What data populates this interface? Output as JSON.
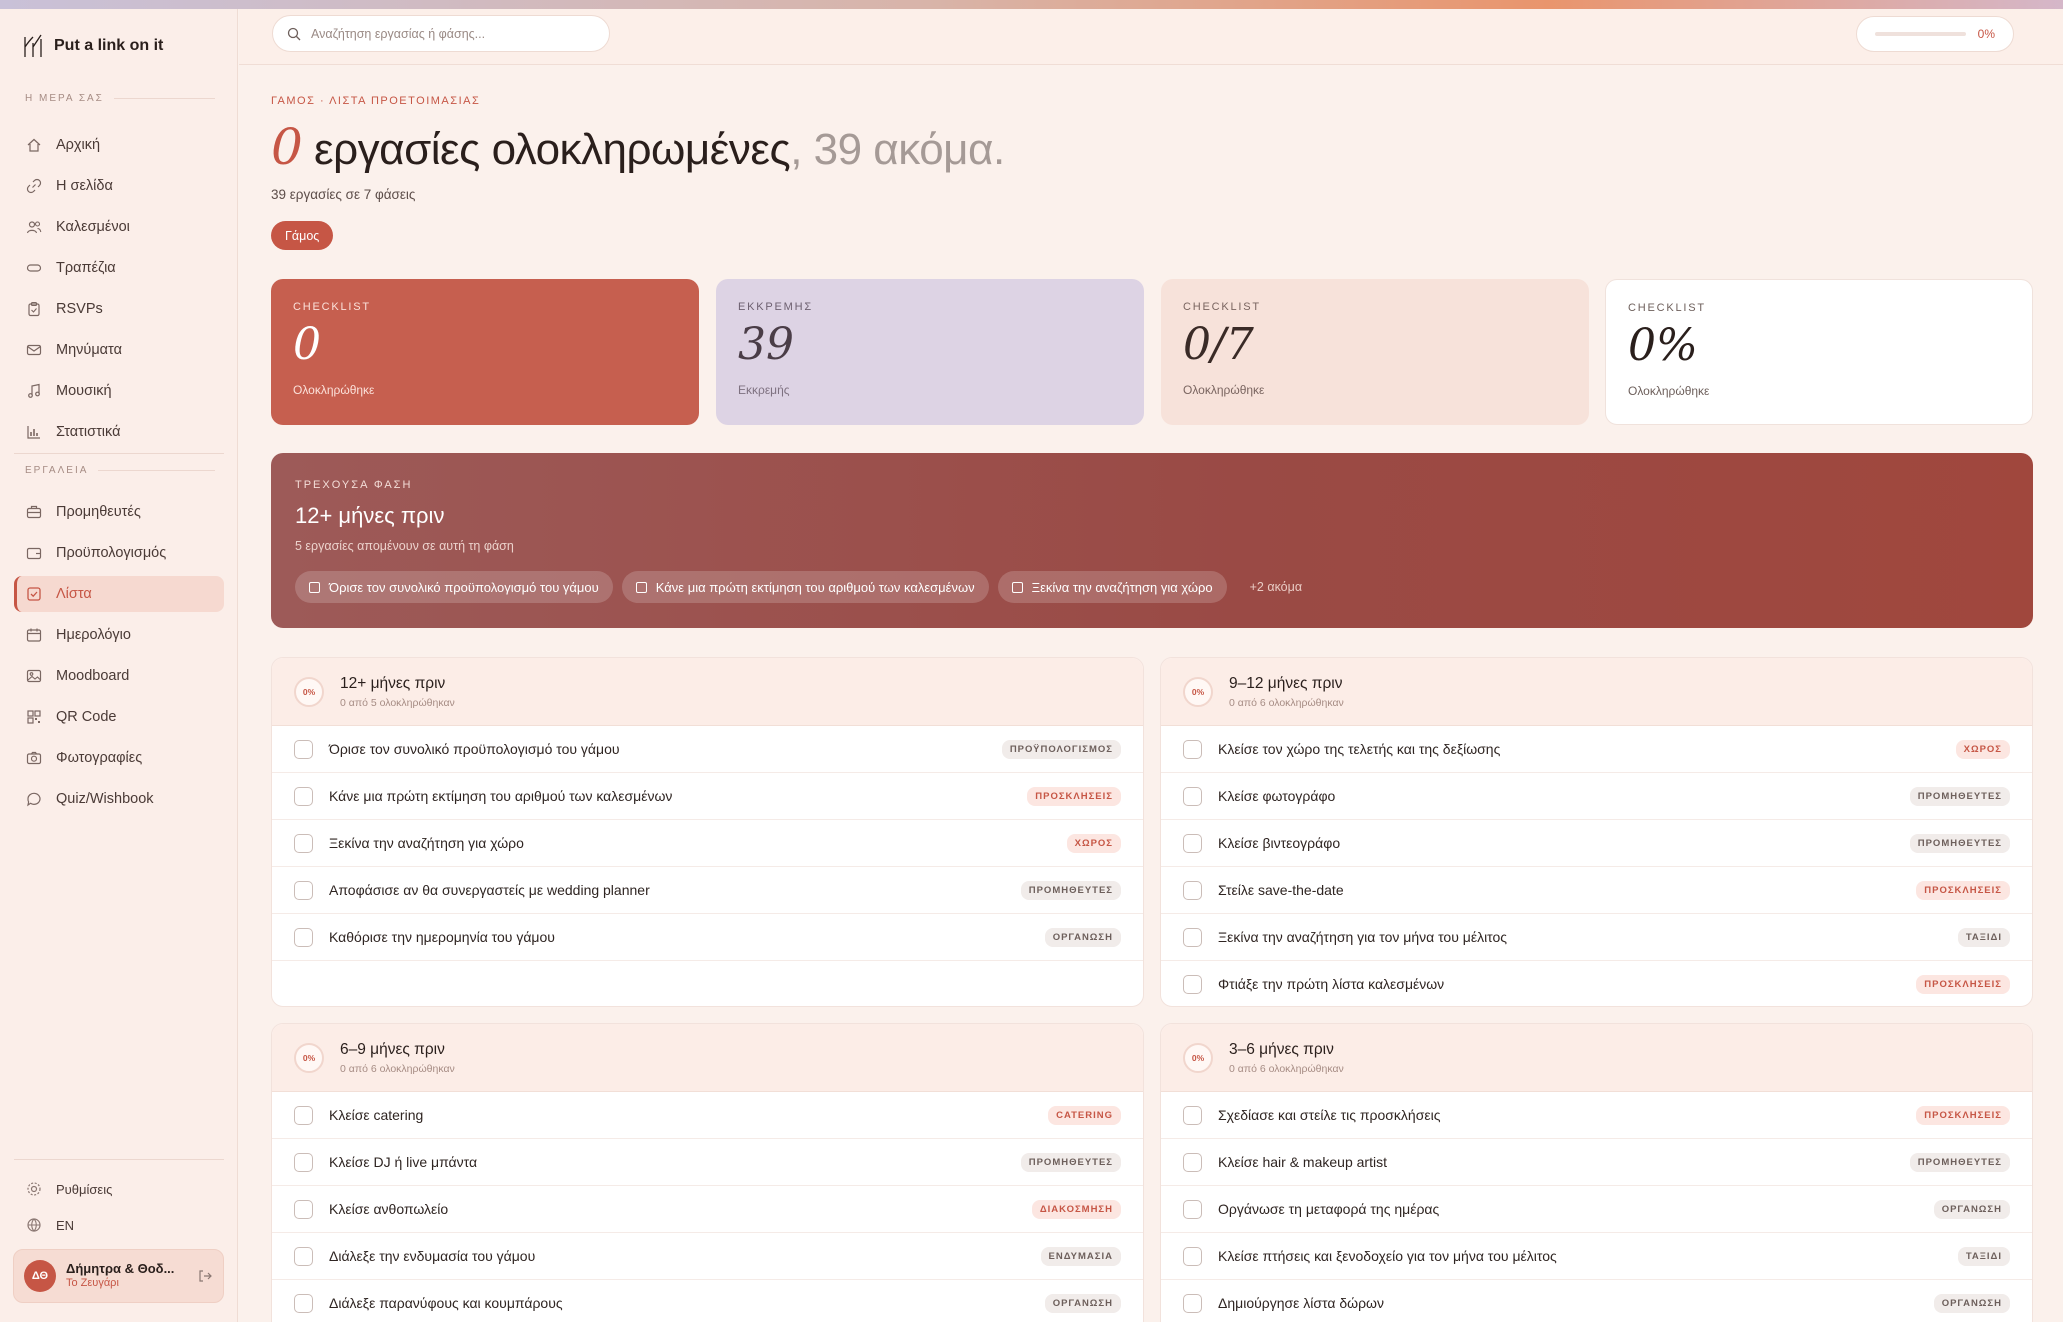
{
  "app": {
    "name": "Put a link on it"
  },
  "sidebar": {
    "section_day": "Η ΜΕΡΑ ΣΑΣ",
    "section_tools": "ΕΡΓΑΛΕΙΑ",
    "items_day": [
      {
        "label": "Αρχική",
        "icon": "home-icon"
      },
      {
        "label": "Η σελίδα",
        "icon": "link-icon"
      },
      {
        "label": "Καλεσμένοι",
        "icon": "users-icon"
      },
      {
        "label": "Τραπέζια",
        "icon": "table-icon"
      },
      {
        "label": "RSVPs",
        "icon": "clipboard-icon"
      },
      {
        "label": "Μηνύματα",
        "icon": "mail-icon"
      },
      {
        "label": "Μουσική",
        "icon": "music-icon"
      },
      {
        "label": "Στατιστικά",
        "icon": "chart-icon"
      }
    ],
    "items_tools": [
      {
        "label": "Προμηθευτές",
        "icon": "briefcase-icon"
      },
      {
        "label": "Προϋπολογισμός",
        "icon": "wallet-icon"
      },
      {
        "label": "Λίστα",
        "icon": "checklist-icon",
        "active": true
      },
      {
        "label": "Ημερολόγιο",
        "icon": "calendar-icon"
      },
      {
        "label": "Moodboard",
        "icon": "image-icon"
      },
      {
        "label": "QR Code",
        "icon": "qr-icon"
      },
      {
        "label": "Φωτογραφίες",
        "icon": "camera-icon"
      },
      {
        "label": "Quiz/Wishbook",
        "icon": "chat-icon"
      }
    ],
    "settings_label": "Ρυθμίσεις",
    "language_label": "EN",
    "user": {
      "initials": "ΔΘ",
      "name": "Δήμητρα & Θοδ...",
      "role": "Το Ζευγάρι"
    }
  },
  "header": {
    "search_placeholder": "Αναζήτηση εργασίας ή φάσης...",
    "progress_label": "0%",
    "progress_value": 0
  },
  "main": {
    "breadcrumb": "ΓΑΜΟΣ · ΛΙΣΤΑ ΠΡΟΕΤΟΙΜΑΣΙΑΣ",
    "headline_number": "0",
    "headline_text": " εργασίες ολοκληρωμένες",
    "headline_rest": ", 39 ακόμα.",
    "subline": "39 εργασίες σε 7 φάσεις",
    "filter_chip": "Γάμος"
  },
  "stats": [
    {
      "label": "CHECKLIST",
      "value": "0",
      "caption": "Ολοκληρώθηκε"
    },
    {
      "label": "ΕΚΚΡΕΜΗΣ",
      "value": "39",
      "caption": "Εκκρεμής"
    },
    {
      "label": "CHECKLIST",
      "value": "0/7",
      "caption": "Ολοκληρώθηκε"
    },
    {
      "label": "CHECKLIST",
      "value": "0%",
      "caption": "Ολοκληρώθηκε"
    }
  ],
  "current_phase": {
    "label": "ΤΡΕΧΟΥΣΑ ΦΑΣΗ",
    "title": "12+ μήνες πριν",
    "subtitle": "5 εργασίες απομένουν σε αυτή τη φάση",
    "chips": [
      "Όρισε τον συνολικό προϋπολογισμό του γάμου",
      "Κάνε μια πρώτη εκτίμηση του αριθμού των καλεσμένων",
      "Ξεκίνα την αναζήτηση για χώρο"
    ],
    "more": "+2 ακόμα"
  },
  "phases": [
    {
      "pct": "0%",
      "title": "12+ μήνες πριν",
      "count": "0 από 5 ολοκληρώθηκαν",
      "tasks": [
        {
          "text": "Όρισε τον συνολικό προϋπολογισμό του γάμου",
          "tag": "ΠΡΟΫΠΟΛΟΓΙΣΜΟΣ",
          "tone": "gray"
        },
        {
          "text": "Κάνε μια πρώτη εκτίμηση του αριθμού των καλεσμένων",
          "tag": "ΠΡΟΣΚΛΗΣΕΙΣ",
          "tone": "red"
        },
        {
          "text": "Ξεκίνα την αναζήτηση για χώρο",
          "tag": "ΧΩΡΟΣ",
          "tone": "red"
        },
        {
          "text": "Αποφάσισε αν θα συνεργαστείς με wedding planner",
          "tag": "ΠΡΟΜΗΘΕΥΤΕΣ",
          "tone": "gray"
        },
        {
          "text": "Καθόρισε την ημερομηνία του γάμου",
          "tag": "ΟΡΓΑΝΩΣΗ",
          "tone": "gray"
        }
      ]
    },
    {
      "pct": "0%",
      "title": "9–12 μήνες πριν",
      "count": "0 από 6 ολοκληρώθηκαν",
      "tasks": [
        {
          "text": "Κλείσε τον χώρο της τελετής και της δεξίωσης",
          "tag": "ΧΩΡΟΣ",
          "tone": "red"
        },
        {
          "text": "Κλείσε φωτογράφο",
          "tag": "ΠΡΟΜΗΘΕΥΤΕΣ",
          "tone": "gray"
        },
        {
          "text": "Κλείσε βιντεογράφο",
          "tag": "ΠΡΟΜΗΘΕΥΤΕΣ",
          "tone": "gray"
        },
        {
          "text": "Στείλε save-the-date",
          "tag": "ΠΡΟΣΚΛΗΣΕΙΣ",
          "tone": "red"
        },
        {
          "text": "Ξεκίνα την αναζήτηση για τον μήνα του μέλιτος",
          "tag": "ΤΑΞΙΔΙ",
          "tone": "gray"
        },
        {
          "text": "Φτιάξε την πρώτη λίστα καλεσμένων",
          "tag": "ΠΡΟΣΚΛΗΣΕΙΣ",
          "tone": "red"
        }
      ]
    },
    {
      "pct": "0%",
      "title": "6–9 μήνες πριν",
      "count": "0 από 6 ολοκληρώθηκαν",
      "tasks": [
        {
          "text": "Κλείσε catering",
          "tag": "CATERING",
          "tone": "red"
        },
        {
          "text": "Κλείσε DJ ή live μπάντα",
          "tag": "ΠΡΟΜΗΘΕΥΤΕΣ",
          "tone": "gray"
        },
        {
          "text": "Κλείσε ανθοπωλείο",
          "tag": "ΔΙΑΚΟΣΜΗΣΗ",
          "tone": "red"
        },
        {
          "text": "Διάλεξε την ενδυμασία του γάμου",
          "tag": "ΕΝΔΥΜΑΣΙΑ",
          "tone": "gray"
        },
        {
          "text": "Διάλεξε παρανύφους και κουμπάρους",
          "tag": "ΟΡΓΑΝΩΣΗ",
          "tone": "gray"
        }
      ]
    },
    {
      "pct": "0%",
      "title": "3–6 μήνες πριν",
      "count": "0 από 6 ολοκληρώθηκαν",
      "tasks": [
        {
          "text": "Σχεδίασε και στείλε τις προσκλήσεις",
          "tag": "ΠΡΟΣΚΛΗΣΕΙΣ",
          "tone": "red"
        },
        {
          "text": "Κλείσε hair & makeup artist",
          "tag": "ΠΡΟΜΗΘΕΥΤΕΣ",
          "tone": "gray"
        },
        {
          "text": "Οργάνωσε τη μεταφορά της ημέρας",
          "tag": "ΟΡΓΑΝΩΣΗ",
          "tone": "gray"
        },
        {
          "text": "Κλείσε πτήσεις και ξενοδοχείο για τον μήνα του μέλιτος",
          "tag": "ΤΑΞΙΔΙ",
          "tone": "gray"
        },
        {
          "text": "Δημιούργησε λίστα δώρων",
          "tag": "ΟΡΓΑΝΩΣΗ",
          "tone": "gray"
        }
      ]
    }
  ],
  "colors": {
    "accent": "#c65645",
    "lavender": "#ddd3e4",
    "blush": "#f7e2da"
  }
}
